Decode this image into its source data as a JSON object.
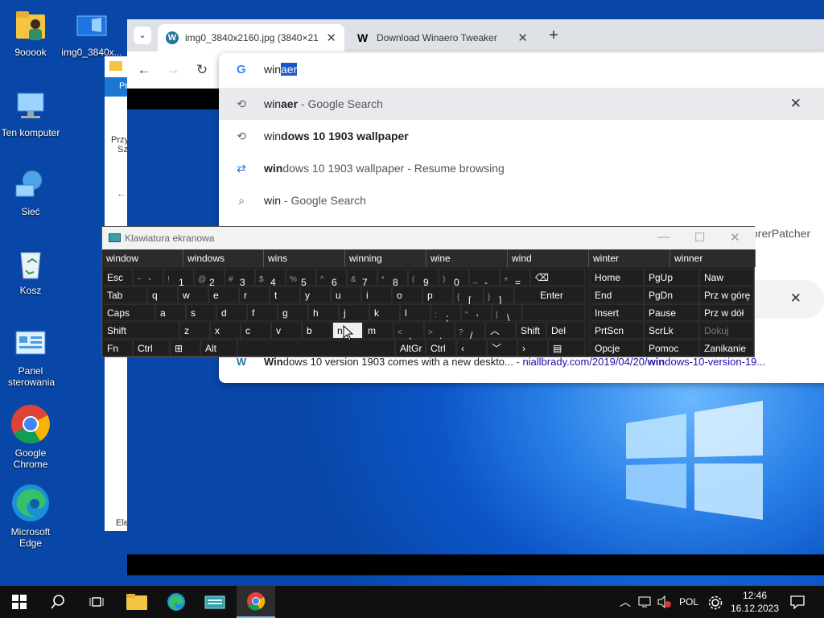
{
  "desktop": {
    "icons": [
      {
        "label": "9ooook"
      },
      {
        "label": "img0_3840x..."
      },
      {
        "label": "Ten komputer"
      },
      {
        "label": "Sieć"
      },
      {
        "label": "Kosz"
      },
      {
        "label": "Panel sterowania"
      },
      {
        "label": "Google Chrome"
      },
      {
        "label": "Microsoft Edge"
      }
    ]
  },
  "explorer": {
    "partial_1": "Pr",
    "partial_2": "Przy",
    "partial_3": "Sz",
    "partial_4": "Ele"
  },
  "chrome": {
    "tabs": [
      {
        "label": "img0_3840x2160.jpg (3840×21",
        "active": true
      },
      {
        "label": "Download Winaero Tweaker",
        "active": false
      }
    ],
    "new_tab": "+",
    "omnibox": {
      "typed": "win",
      "autocomplete": "aer"
    },
    "suggestions": [
      {
        "icon": "search-history-icon",
        "prefix": "win",
        "bold": "aer",
        "suffix": " - Google Search",
        "removable": true
      },
      {
        "icon": "history-icon",
        "prefix": "win",
        "bold": "dows 10 1903 wallpaper",
        "suffix": "",
        "removable": false
      },
      {
        "icon": "journey-icon",
        "prefix": "win",
        "bold": "",
        "suffix": "dows 10 1903 wallpaper - Resume browsing",
        "removable": false
      },
      {
        "icon": "search-icon",
        "prefix": "win",
        "bold": "",
        "suffix": " - Google Search",
        "removable": false
      }
    ],
    "hidden_row_text": "orerPatcher",
    "last_row": {
      "title_prefix": "Win",
      "title_rest": "dows 10 version 1903 comes with a new deskto...",
      "sep": " - ",
      "url_prefix": "niallbrady.com/2019/04/20/",
      "url_bold": "win",
      "url_rest": "dows-10-version-19..."
    }
  },
  "osk": {
    "title": "Klawiatura ekranowa",
    "suggestions": [
      "window",
      "windows",
      "wins",
      "winning",
      "wine",
      "wind",
      "winter",
      "winner"
    ],
    "row1": [
      {
        "sh": "~",
        "k": "`"
      },
      {
        "sh": "!",
        "k": "1"
      },
      {
        "sh": "@",
        "k": "2"
      },
      {
        "sh": "#",
        "k": "3"
      },
      {
        "sh": "$",
        "k": "4"
      },
      {
        "sh": "%",
        "k": "5"
      },
      {
        "sh": "^",
        "k": "6"
      },
      {
        "sh": "&",
        "k": "7"
      },
      {
        "sh": "*",
        "k": "8"
      },
      {
        "sh": "(",
        "k": "9"
      },
      {
        "sh": ")",
        "k": "0"
      },
      {
        "sh": "_",
        "k": "-"
      },
      {
        "sh": "+",
        "k": "="
      }
    ],
    "esc": "Esc",
    "tab": "Tab",
    "caps": "Caps",
    "shift": "Shift",
    "fn": "Fn",
    "ctrl": "Ctrl",
    "alt": "Alt",
    "altgr": "AltGr",
    "enter": "Enter",
    "del": "Del",
    "row2": [
      "q",
      "w",
      "e",
      "r",
      "t",
      "y",
      "u",
      "i",
      "o",
      "p"
    ],
    "row2b": [
      {
        "sh": "{",
        "k": "["
      },
      {
        "sh": "}",
        "k": "]"
      }
    ],
    "row3": [
      "a",
      "s",
      "d",
      "f",
      "g",
      "h",
      "j",
      "k",
      "l"
    ],
    "row3b": [
      {
        "sh": ":",
        "k": ";"
      },
      {
        "sh": "\"",
        "k": "'"
      },
      {
        "sh": "|",
        "k": "\\"
      }
    ],
    "row4": [
      "z",
      "x",
      "c",
      "v",
      "b",
      "n",
      "m"
    ],
    "row4b": [
      {
        "sh": "<",
        "k": ","
      },
      {
        "sh": ">",
        "k": "."
      },
      {
        "sh": "?",
        "k": "/"
      }
    ],
    "nav": [
      [
        "Home",
        "PgUp",
        "Naw"
      ],
      [
        "End",
        "PgDn",
        "Prz w górę"
      ],
      [
        "Insert",
        "Pause",
        "Prz w dół"
      ],
      [
        "PrtScn",
        "ScrLk",
        "Dokuj"
      ],
      [
        "Opcje",
        "Pomoc",
        "Zanikanie"
      ]
    ],
    "pressed_key": "n"
  },
  "taskbar": {
    "language": "POL",
    "time": "12:46",
    "date": "16.12.2023"
  }
}
